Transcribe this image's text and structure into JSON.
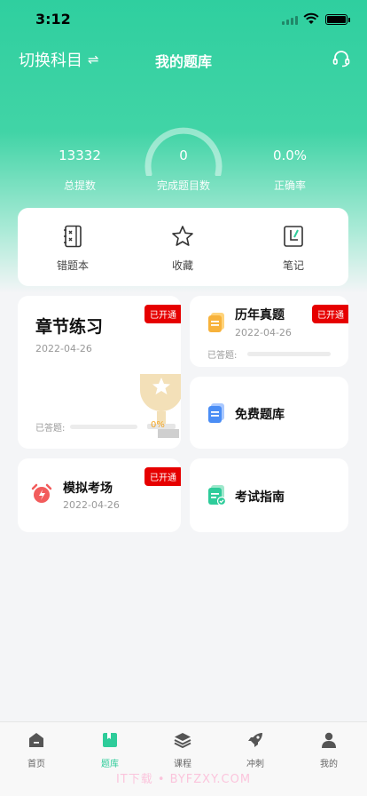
{
  "status": {
    "time": "3:12"
  },
  "nav": {
    "switch_label": "切换科目",
    "switch_glyph": "⇌",
    "title": "我的题库"
  },
  "stats": [
    {
      "value": "13332",
      "label": "总提数"
    },
    {
      "value": "0",
      "label": "完成题目数"
    },
    {
      "value": "0.0%",
      "label": "正确率"
    }
  ],
  "tools": [
    {
      "label": "错题本",
      "icon": "wrong-book-icon"
    },
    {
      "label": "收藏",
      "icon": "star-icon"
    },
    {
      "label": "笔记",
      "icon": "note-icon"
    }
  ],
  "cards": {
    "chapter": {
      "title": "章节练习",
      "date": "2022-04-26",
      "badge": "已开通",
      "done_label": "已答题:",
      "progress": "0%"
    },
    "past": {
      "title": "历年真题",
      "date": "2022-04-26",
      "badge": "已开通",
      "done_label": "已答题:"
    },
    "free": {
      "title": "免费题库"
    },
    "mock": {
      "title": "模拟考场",
      "date": "2022-04-26",
      "badge": "已开通"
    },
    "guide": {
      "title": "考试指南"
    }
  },
  "tabs": [
    {
      "label": "首页",
      "icon": "home-icon"
    },
    {
      "label": "题库",
      "icon": "question-bank-icon",
      "active": true
    },
    {
      "label": "课程",
      "icon": "course-layers-icon"
    },
    {
      "label": "冲刺",
      "icon": "rocket-icon"
    },
    {
      "label": "我的",
      "icon": "profile-icon"
    }
  ],
  "watermark": "IT下载 • BYFZXY.COM",
  "colors": {
    "accent": "#2ecc9a",
    "badge": "#e60000",
    "progress_text": "#f5a623"
  }
}
